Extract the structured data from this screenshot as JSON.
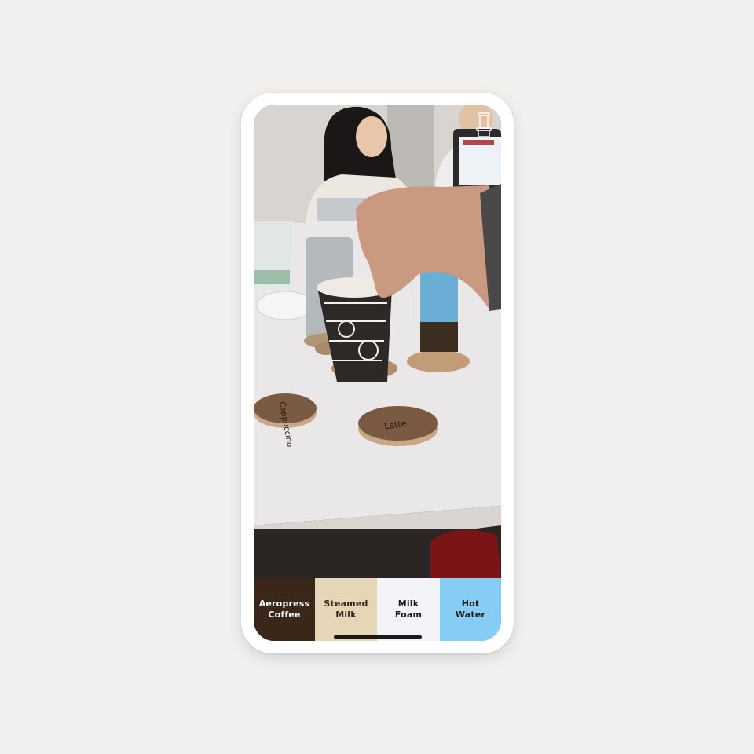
{
  "coasters": {
    "latte_label": "Latte",
    "cappuccino_label": "Cappuccino"
  },
  "ingredients": [
    {
      "label": "Aeropress\nCoffee",
      "color": "#3b2719",
      "text_color": "#ffffff"
    },
    {
      "label": "Steamed\nMilk",
      "color": "#e6d6b8",
      "text_color": "#3b2719"
    },
    {
      "label": "Milk\nFoam",
      "color": "#f3f2f6",
      "text_color": "#1c1c1c"
    },
    {
      "label": "Hot\nWater",
      "color": "#86cdf6",
      "text_color": "#1c1c1c"
    }
  ],
  "colors": {
    "coaster": "#7a5a43",
    "coaster_edge": "#c9a888",
    "ar_cup_blue": "#6aaed6",
    "ar_cup_dark": "#3c2d22"
  },
  "icons": {
    "ar_toggle": "aeropress-outline-icon"
  }
}
